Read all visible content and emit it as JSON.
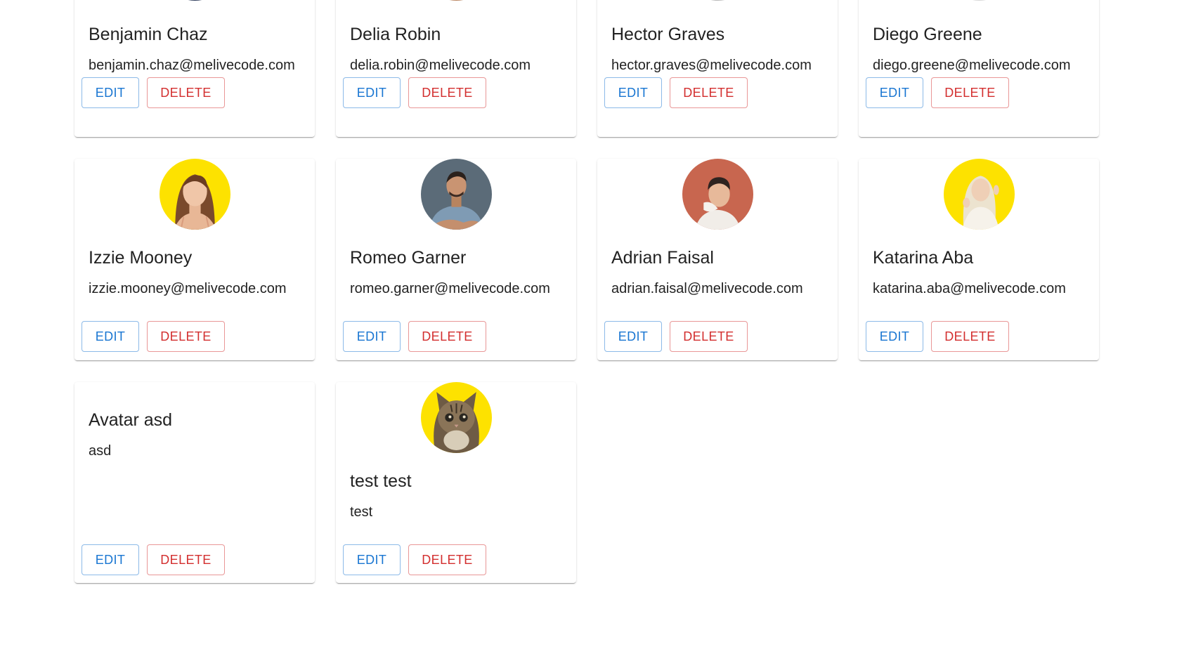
{
  "users": [
    {
      "name": "Benjamin Chaz",
      "email": "benjamin.chaz@melivecode.com",
      "avatar": "partial-dark",
      "edit_label": "EDIT",
      "delete_label": "DELETE"
    },
    {
      "name": "Delia Robin",
      "email": "delia.robin@melivecode.com",
      "avatar": "partial-warm",
      "edit_label": "EDIT",
      "delete_label": "DELETE"
    },
    {
      "name": "Hector Graves",
      "email": "hector.graves@melivecode.com",
      "avatar": "partial-gray",
      "edit_label": "EDIT",
      "delete_label": "DELETE"
    },
    {
      "name": "Diego Greene",
      "email": "diego.greene@melivecode.com",
      "avatar": "partial-light",
      "edit_label": "EDIT",
      "delete_label": "DELETE"
    },
    {
      "name": "Izzie Mooney",
      "email": "izzie.mooney@melivecode.com",
      "avatar": "woman-yellow",
      "edit_label": "EDIT",
      "delete_label": "DELETE"
    },
    {
      "name": "Romeo Garner",
      "email": "romeo.garner@melivecode.com",
      "avatar": "man-gray",
      "edit_label": "EDIT",
      "delete_label": "DELETE"
    },
    {
      "name": "Adrian Faisal",
      "email": "adrian.faisal@melivecode.com",
      "avatar": "man-red",
      "edit_label": "EDIT",
      "delete_label": "DELETE"
    },
    {
      "name": "Katarina Aba",
      "email": "katarina.aba@melivecode.com",
      "avatar": "woman-blonde-yellow",
      "edit_label": "EDIT",
      "delete_label": "DELETE"
    },
    {
      "name": "Avatar asd",
      "email": "asd",
      "avatar": "none",
      "edit_label": "EDIT",
      "delete_label": "DELETE"
    },
    {
      "name": "test test",
      "email": "test",
      "avatar": "cat-yellow",
      "edit_label": "EDIT",
      "delete_label": "DELETE"
    }
  ],
  "colors": {
    "primary": "#1976d2",
    "error": "#d32f2f",
    "text": "#212121",
    "avatar_yellow": "#fde200",
    "avatar_slate": "#5b6b78",
    "avatar_coral": "#c8664f"
  }
}
